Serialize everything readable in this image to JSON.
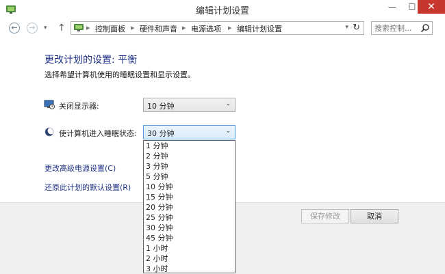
{
  "window": {
    "title": "编辑计划设置",
    "min_glyph": "—",
    "max_glyph": "☐",
    "close_glyph": "✕"
  },
  "nav": {
    "back_glyph": "←",
    "forward_glyph": "→",
    "recent_glyph": "▾",
    "up_glyph": "↑",
    "breadcrumbs": [
      "控制面板",
      "硬件和声音",
      "电源选项",
      "编辑计划设置"
    ],
    "separator": "▸",
    "address_dropdown_glyph": "▾",
    "refresh_glyph": "↻",
    "search_placeholder": "搜索控制..."
  },
  "main": {
    "heading": "更改计划的设置: 平衡",
    "subheading": "选择希望计算机使用的睡眠设置和显示设置。",
    "display": {
      "label": "关闭显示器:",
      "value": "10 分钟",
      "arrow": "⌄"
    },
    "sleep": {
      "label": "使计算机进入睡眠状态:",
      "value": "30 分钟",
      "arrow": "⌄"
    },
    "links": {
      "advanced": "更改高级电源设置(C)",
      "restore": "还原此计划的默认设置(R)"
    }
  },
  "sleep_options": [
    "1 分钟",
    "2 分钟",
    "3 分钟",
    "5 分钟",
    "10 分钟",
    "15 分钟",
    "20 分钟",
    "25 分钟",
    "30 分钟",
    "45 分钟",
    "1 小时",
    "2 小时",
    "3 小时"
  ],
  "footer": {
    "save_label": "保存修改",
    "cancel_label": "取消"
  },
  "colors": {
    "heading": "#1e3287",
    "close_button": "#c7372f",
    "footer_bg": "#f0f0f0",
    "dropdown_border": "#646464"
  }
}
